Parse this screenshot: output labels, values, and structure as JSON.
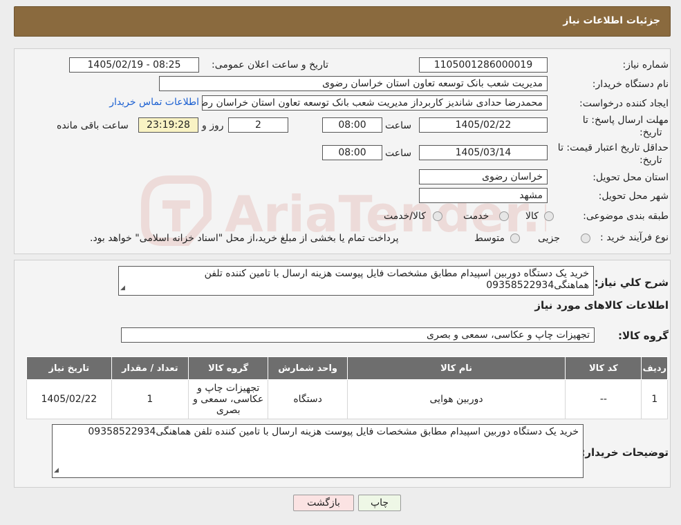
{
  "header": {
    "title": "جزئیات اطلاعات نیاز"
  },
  "form": {
    "need_number_label": "شماره نیاز:",
    "need_number": "1105001286000019",
    "announce_label": "تاریخ و ساعت اعلان عمومی:",
    "announce_value": "1405/02/19 - 08:25",
    "buyer_org_label": "نام دستگاه خریدار:",
    "buyer_org": "مدیریت شعب بانک توسعه تعاون استان خراسان رضوی",
    "creator_label": "ایجاد کننده درخواست:",
    "creator": "محمدرضا حدادی شاندیز کاربرداز مدیریت شعب بانک توسعه تعاون استان خراسان رضوی",
    "contact_link": "اطلاعات تماس خریدار",
    "reply_deadline_label_1": "مهلت ارسال پاسخ: تا",
    "reply_deadline_label_2": "تاریخ:",
    "reply_date": "1405/02/22",
    "time_label": "ساعت",
    "reply_time": "08:00",
    "days": "2",
    "days_label": "روز و",
    "remaining_time": "23:19:28",
    "remaining_label": "ساعت باقی مانده",
    "validity_label_1": "حداقل تاریخ اعتبار قیمت: تا",
    "validity_label_2": "تاریخ:",
    "validity_date": "1405/03/14",
    "validity_time": "08:00",
    "province_label": "استان محل تحویل:",
    "province": "خراسان رضوی",
    "city_label": "شهر محل تحویل:",
    "city": "مشهد",
    "category_label": "طبقه بندی موضوعی:",
    "category_options": [
      "کالا",
      "خدمت",
      "کالا/خدمت"
    ],
    "process_label": "نوع فرآیند خرید :",
    "process_options": [
      "جزیی",
      "متوسط"
    ],
    "process_note": "پرداخت تمام یا بخشی از مبلغ خرید،از محل \"اسناد خزانه اسلامی\" خواهد بود."
  },
  "summary": {
    "label": "شرح کلي نياز:",
    "text": "خرید یک دستگاه دوربین اسپیدام مطابق مشخصات فایل پیوست هزینه ارسال با تامین کننده تلفن هماهنگی09358522934",
    "items_title": "اطلاعات کالاهای مورد نیاز",
    "group_label": "گروه کالا:",
    "group_value": "تجهیزات چاپ و عکاسی، سمعی و بصری"
  },
  "table": {
    "headers": [
      "ردیف",
      "کد کالا",
      "نام کالا",
      "واحد شمارش",
      "گروه کالا",
      "تعداد / مقدار",
      "تاریخ نیاز"
    ],
    "rows": [
      [
        "1",
        "--",
        "دوربین هوایی",
        "دستگاه",
        "تجهیزات چاپ و عکاسی، سمعی و بصری",
        "1",
        "1405/02/22"
      ]
    ]
  },
  "buyer_notes": {
    "label": "توضیحات خریدار:",
    "text": "خرید یک دستگاه دوربین اسپیدام مطابق مشخصات فایل پیوست هزینه ارسال با تامین کننده تلفن هماهنگی09358522934"
  },
  "buttons": {
    "print": "چاپ",
    "back": "بازگشت"
  },
  "watermark": {
    "text": "AriaTender.neT",
    "color": "#c0392b"
  },
  "colors": {
    "header_bg": "#8a6a3e",
    "table_header_bg": "#6e6e6e",
    "link": "#1a5fd1",
    "highlight": "#f9f3c4"
  }
}
